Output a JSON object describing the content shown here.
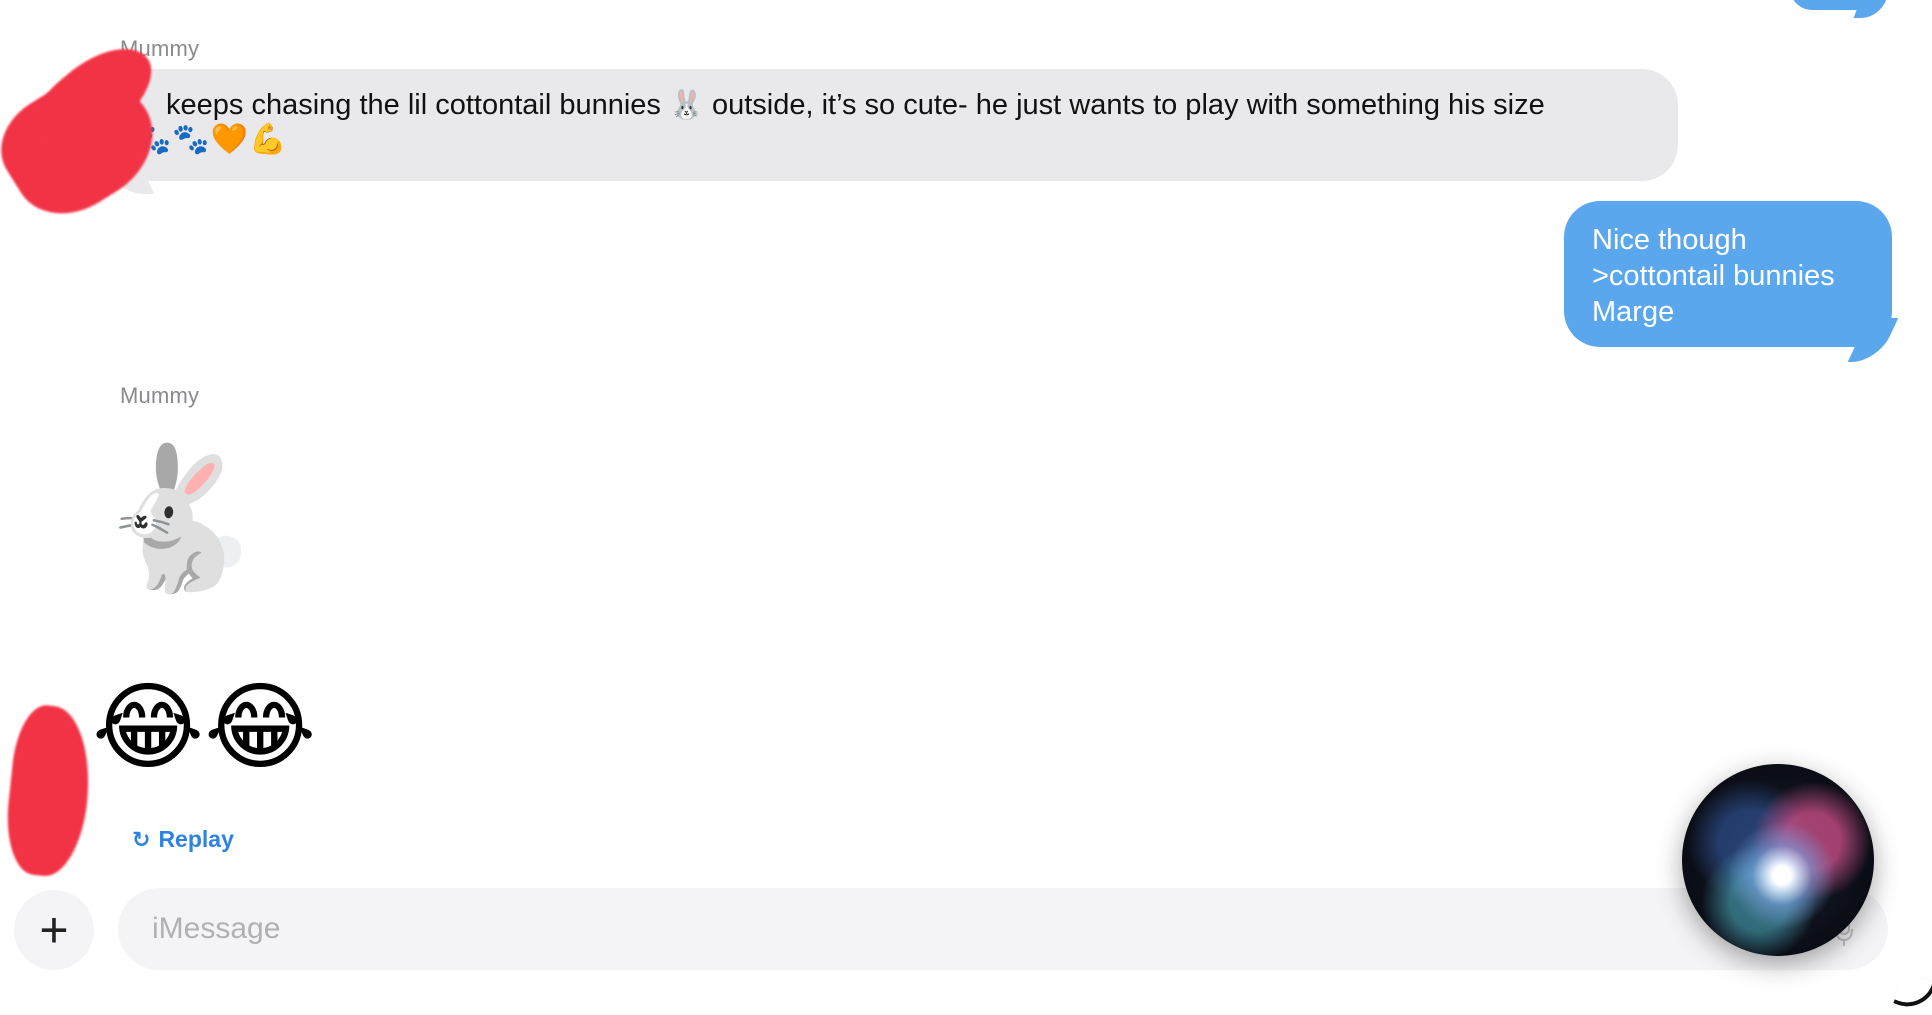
{
  "colors": {
    "incoming_bubble": "#e9e9eb",
    "outgoing_bubble": "#5aa7ee",
    "accent": "#2f82e0",
    "redaction": "#f23346"
  },
  "messages": [
    {
      "sender": "Mummy",
      "text": "keeps chasing the lil cottontail bunnies",
      "inline_emoji": "🐰",
      "text_after": "outside, it’s so cute- he just wants to play with something his size",
      "emoji_line": "🐾🐾🧡💪"
    },
    {
      "outgoing": true,
      "lines": [
        "Nice though",
        ">cottontail bunnies",
        "Marge"
      ]
    },
    {
      "sender": "Mummy",
      "emoji_big": "🐇",
      "emoji_laugh": "😂😂"
    }
  ],
  "replay_label": "Replay",
  "replay_icon": "↻",
  "composer": {
    "plus_label": "+",
    "placeholder": "iMessage"
  },
  "icons": {
    "plus": "plus-icon",
    "mic": "microphone-icon",
    "siri": "siri-orb-icon",
    "replay": "replay-icon"
  }
}
